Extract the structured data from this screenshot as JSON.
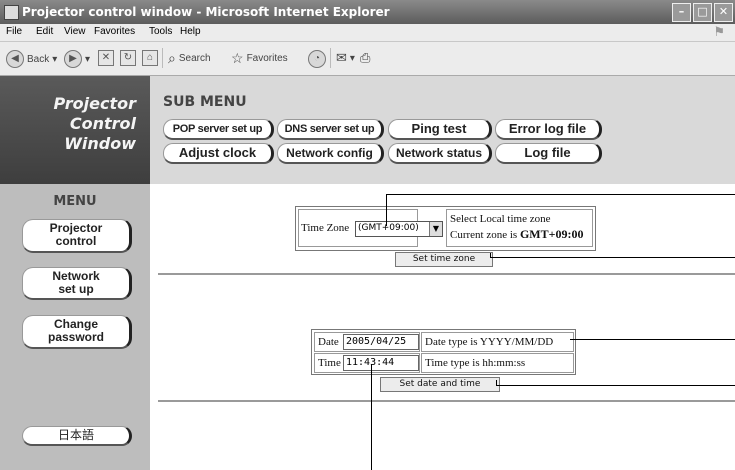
{
  "window": {
    "title": "Projector control window - Microsoft Internet Explorer",
    "controls": [
      "–",
      "□",
      "✕"
    ]
  },
  "menubar": [
    "File",
    "Edit",
    "View",
    "Favorites",
    "Tools",
    "Help"
  ],
  "toolbar": {
    "back": "Back",
    "search": "Search",
    "favorites": "Favorites"
  },
  "brand": [
    "Projector",
    "Control",
    "Window"
  ],
  "submenu": {
    "title": "SUB MENU",
    "row1": [
      "POP server set up",
      "DNS server set up",
      "Ping test",
      "Error log file"
    ],
    "row2": [
      "Adjust clock",
      "Network config",
      "Network status",
      "Log file"
    ]
  },
  "sidebar": {
    "title": "MENU",
    "projector": [
      "Projector",
      "control"
    ],
    "network": [
      "Network",
      "set up"
    ],
    "password": [
      "Change",
      "password"
    ],
    "language": "日本語"
  },
  "timezone": {
    "label": "Time Zone",
    "selected": "(GMT+09:00)",
    "hint_line1": "Select Local time zone",
    "hint_line2_prefix": "Current zone is ",
    "hint_line2_value": "GMT+09:00",
    "button": "Set time zone"
  },
  "datetime": {
    "date_label": "Date",
    "date_value": "2005/04/25",
    "date_hint": "Date type is YYYY/MM/DD",
    "time_label": "Time",
    "time_value": "11:43:44",
    "time_hint": "Time type is hh:mm:ss",
    "button": "Set date and time"
  }
}
